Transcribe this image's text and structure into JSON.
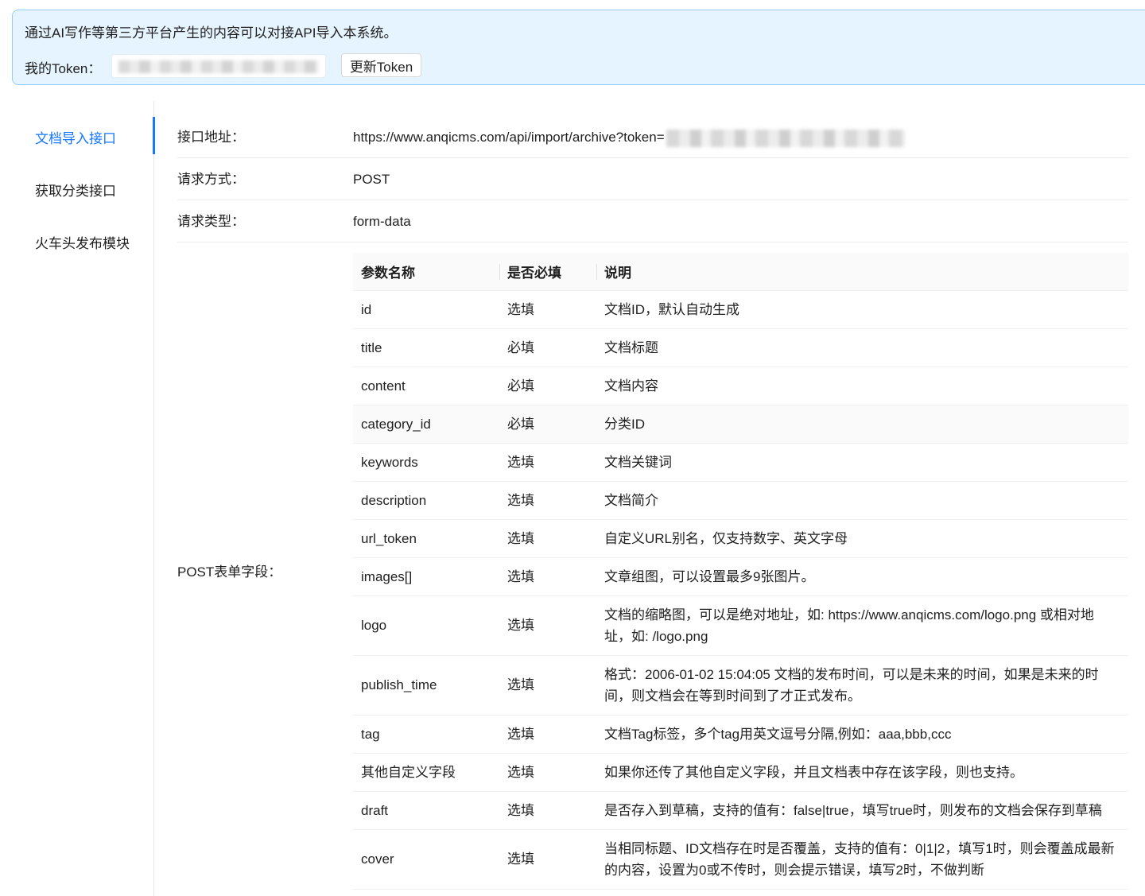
{
  "notice": {
    "text": "通过AI写作等第三方平台产生的内容可以对接API导入本系统。",
    "token_label": "我的Token：",
    "update_button": "更新Token"
  },
  "tabs": [
    {
      "label": "文档导入接口",
      "active": true
    },
    {
      "label": "获取分类接口",
      "active": false
    },
    {
      "label": "火车头发布模块",
      "active": false
    }
  ],
  "info": {
    "url_label": "接口地址：",
    "url_value": "https://www.anqicms.com/api/import/archive?token=",
    "method_label": "请求方式：",
    "method_value": "POST",
    "type_label": "请求类型：",
    "type_value": "form-data",
    "fields_label": "POST表单字段："
  },
  "table": {
    "headers": [
      "参数名称",
      "是否必填",
      "说明"
    ],
    "rows": [
      {
        "name": "id",
        "required": "选填",
        "desc": "文档ID，默认自动生成"
      },
      {
        "name": "title",
        "required": "必填",
        "desc": "文档标题"
      },
      {
        "name": "content",
        "required": "必填",
        "desc": "文档内容"
      },
      {
        "name": "category_id",
        "required": "必填",
        "desc": "分类ID"
      },
      {
        "name": "keywords",
        "required": "选填",
        "desc": "文档关键词"
      },
      {
        "name": "description",
        "required": "选填",
        "desc": "文档简介"
      },
      {
        "name": "url_token",
        "required": "选填",
        "desc": "自定义URL别名，仅支持数字、英文字母"
      },
      {
        "name": "images[]",
        "required": "选填",
        "desc": "文章组图，可以设置最多9张图片。"
      },
      {
        "name": "logo",
        "required": "选填",
        "desc": "文档的缩略图，可以是绝对地址，如: https://www.anqicms.com/logo.png 或相对地址，如: /logo.png"
      },
      {
        "name": "publish_time",
        "required": "选填",
        "desc": "格式：2006-01-02 15:04:05 文档的发布时间，可以是未来的时间，如果是未来的时间，则文档会在等到时间到了才正式发布。"
      },
      {
        "name": "tag",
        "required": "选填",
        "desc": "文档Tag标签，多个tag用英文逗号分隔,例如：aaa,bbb,ccc"
      },
      {
        "name": "其他自定义字段",
        "required": "选填",
        "desc": "如果你还传了其他自定义字段，并且文档表中存在该字段，则也支持。"
      },
      {
        "name": "draft",
        "required": "选填",
        "desc": "是否存入到草稿，支持的值有：false|true，填写true时，则发布的文档会保存到草稿"
      },
      {
        "name": "cover",
        "required": "选填",
        "desc": "当相同标题、ID文档存在时是否覆盖，支持的值有：0|1|2，填写1时，则会覆盖成最新的内容，设置为0或不传时，则会提示错误，填写2时，不做判断"
      }
    ]
  }
}
